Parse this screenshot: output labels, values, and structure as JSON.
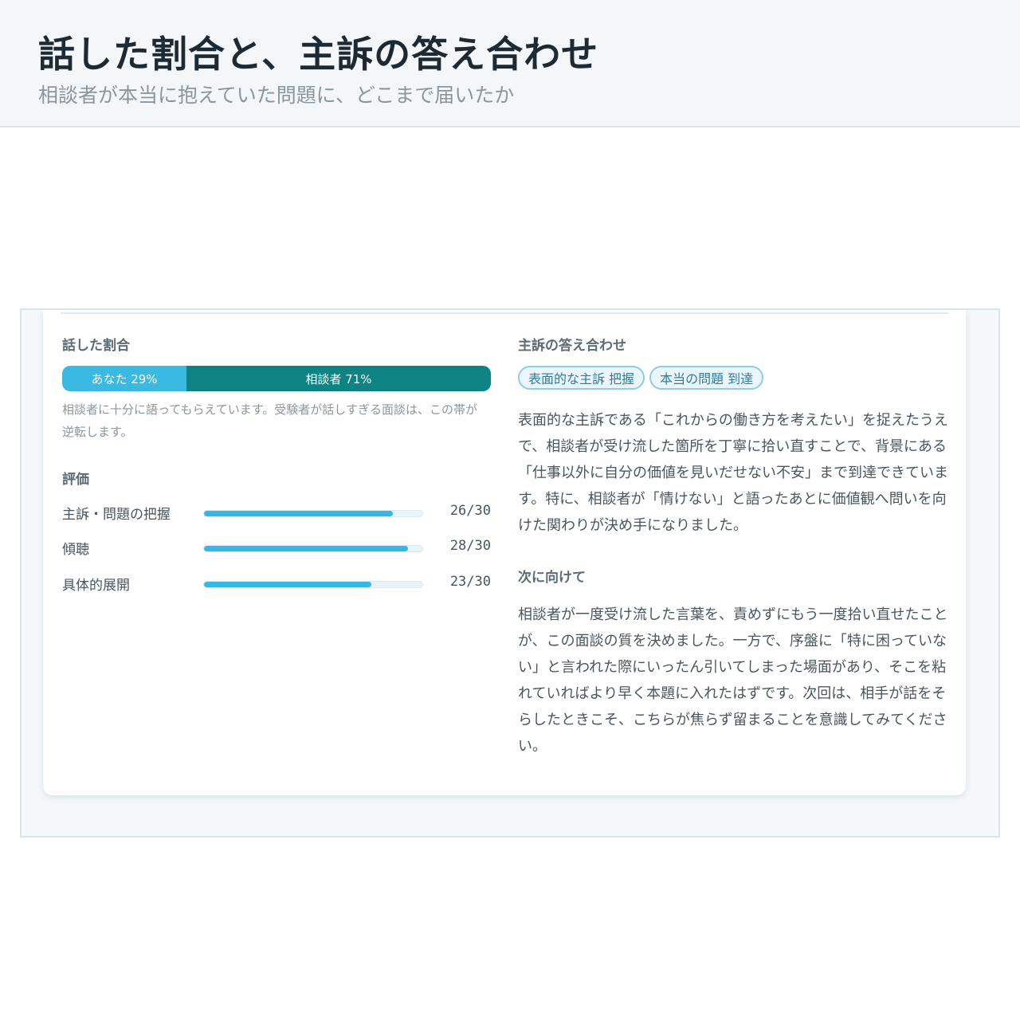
{
  "header": {
    "title": "話した割合と、主訴の答え合わせ",
    "subtitle": "相談者が本当に抱えていた問題に、どこまで届いたか"
  },
  "talk_ratio": {
    "title": "話した割合",
    "you_label": "あなた 29%",
    "you_fraction": 0.29,
    "client_label": "相談者 71%",
    "client_fraction": 0.71,
    "note": "相談者に十分に語ってもらえています。受験者が話しすぎる面談は、この帯が逆転します。"
  },
  "evaluation": {
    "title": "評価",
    "items": [
      {
        "label": "主訴・問題の把握",
        "value": "26/30",
        "fraction": 0.8667
      },
      {
        "label": "傾聴",
        "value": "28/30",
        "fraction": 0.9333
      },
      {
        "label": "具体的展開",
        "value": "23/30",
        "fraction": 0.7667
      }
    ]
  },
  "complaint_check": {
    "title": "主訴の答え合わせ",
    "tags": [
      "表面的な主訴 把握",
      "本当の問題 到達"
    ],
    "body": "表面的な主訴である「これからの働き方を考えたい」を捉えたうえで、相談者が受け流した箇所を丁寧に拾い直すことで、背景にある「仕事以外に自分の価値を見いだせない不安」まで到達できています。特に、相談者が「情けない」と語ったあとに価値観へ問いを向けた関わりが決め手になりました。"
  },
  "next_steps": {
    "title": "次に向けて",
    "body": "相談者が一度受け流した言葉を、責めずにもう一度拾い直せたことが、この面談の質を決めました。一方で、序盤に「特に困っていない」と言われた際にいったん引いてしまった場面があり、そこを粘れていればより早く本題に入れたはずです。次回は、相手が話をそらしたときこそ、こちらが焦らず留まることを意識してみてください。"
  },
  "colors": {
    "you": "#3ab9e2",
    "client": "#0e8383",
    "score_fill": "#35b8e2"
  }
}
